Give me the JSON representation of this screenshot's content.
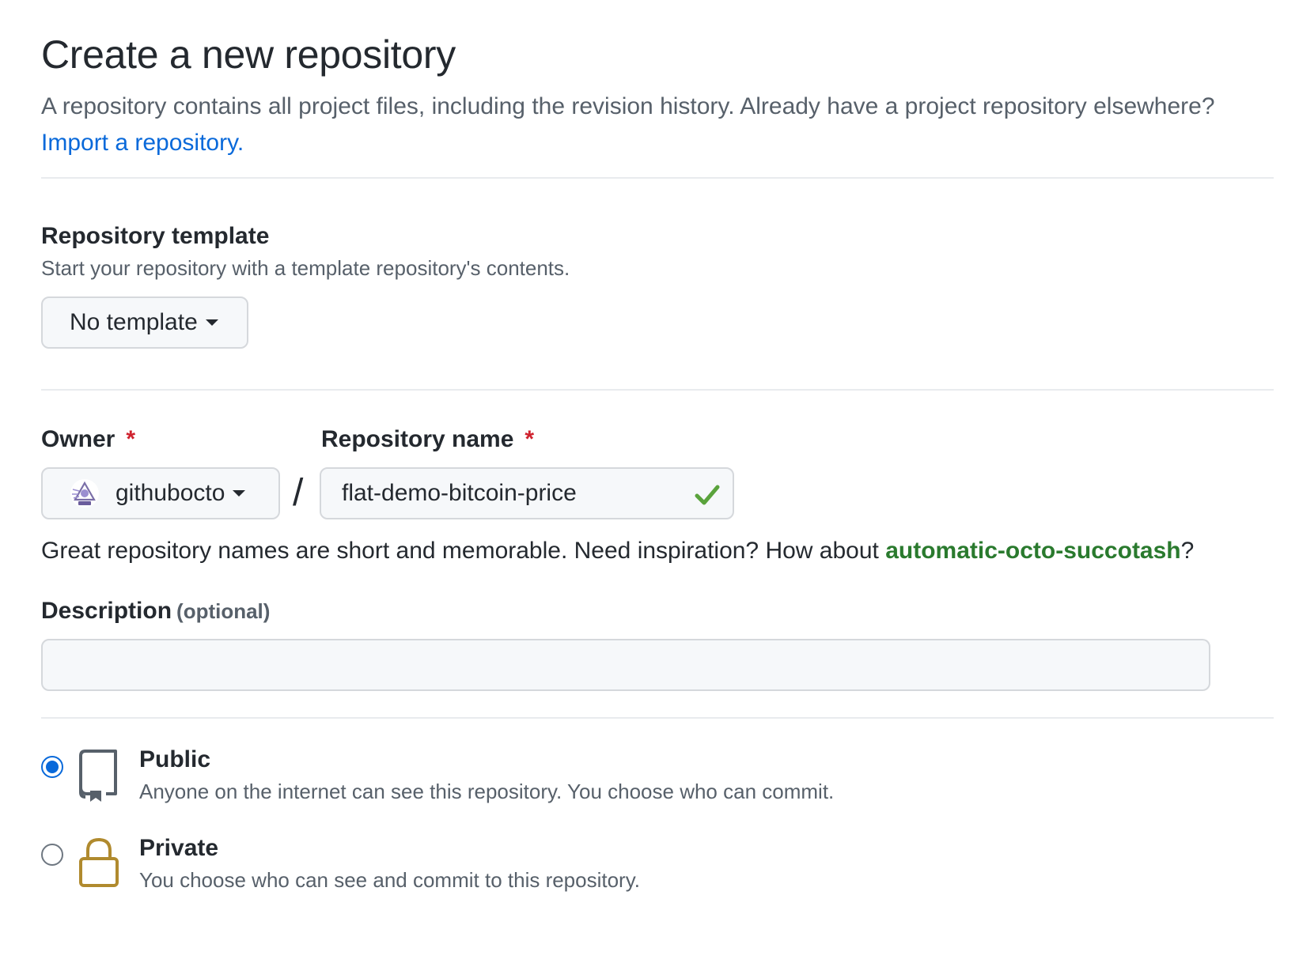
{
  "header": {
    "title": "Create a new repository",
    "description": "A repository contains all project files, including the revision history. Already have a project repository elsewhere?",
    "import_link": "Import a repository."
  },
  "template": {
    "heading": "Repository template",
    "note": "Start your repository with a template repository's contents.",
    "selected": "No template"
  },
  "owner": {
    "label": "Owner",
    "required_mark": "*",
    "selected": "githubocto"
  },
  "separator": "/",
  "repo_name": {
    "label": "Repository name",
    "required_mark": "*",
    "value": "flat-demo-bitcoin-price",
    "valid": true
  },
  "hint": {
    "text": "Great repository names are short and memorable. Need inspiration? How about",
    "suggestion": "automatic-octo-succotash",
    "suffix": "?"
  },
  "description": {
    "label": "Description",
    "optional_tag": "(optional)",
    "value": ""
  },
  "visibility": {
    "selected": "public",
    "options": [
      {
        "id": "public",
        "title": "Public",
        "description": "Anyone on the internet can see this repository. You choose who can commit.",
        "icon": "repo-icon"
      },
      {
        "id": "private",
        "title": "Private",
        "description": "You choose who can see and commit to this repository.",
        "icon": "lock-icon"
      }
    ]
  },
  "colors": {
    "link": "#0969da",
    "suggestion": "#2a7a2e",
    "required": "#cf222e",
    "check": "#5aa33c",
    "lock": "#b08a2e"
  }
}
